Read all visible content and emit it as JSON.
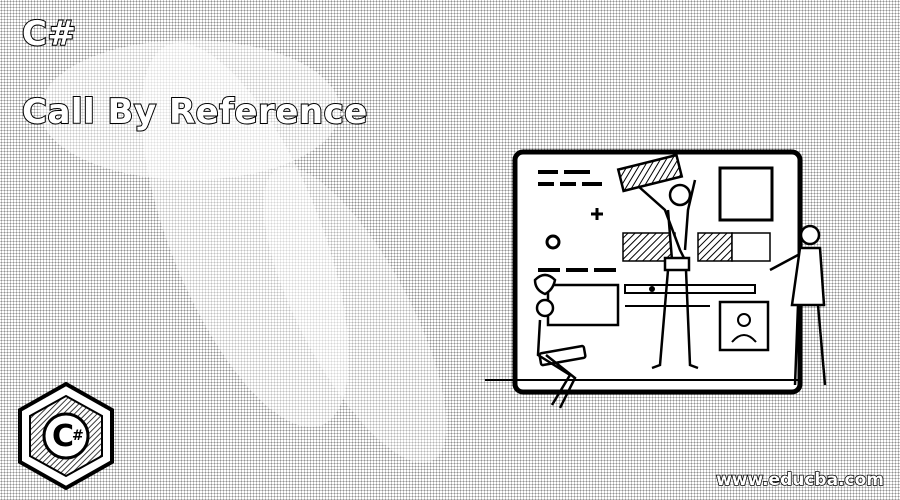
{
  "heading": {
    "line1": "C#",
    "line2": "Call By Reference"
  },
  "logo": {
    "icon": "csharp-logo-icon",
    "letter": "C",
    "symbol": "#"
  },
  "illustration": {
    "icon": "team-building-webpage-illustration"
  },
  "footer": {
    "url": "www.educba.com"
  },
  "colors": {
    "background": "#ffffff",
    "ink": "#000000",
    "dither": "#3a3a3a"
  }
}
